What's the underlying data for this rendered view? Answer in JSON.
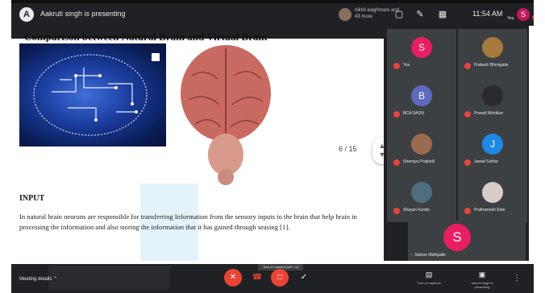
{
  "topbar": {
    "presenting_text": "Aakruti singh is presenting",
    "joined_text": "nikhil waghmare and 43 more",
    "time": "11:54 AM",
    "you_initial": "S",
    "you_label": "You"
  },
  "slide": {
    "title": "Comparison between Natural Brain and Virtual Brain",
    "page_indicator": "6 / 15",
    "section_heading": "INPUT",
    "paragraph": "In natural brain neurons are responsible for transferring Information from the sensory inputs to the brain that help brain in processing the information and also storing the information that it has gained through seasing [1]."
  },
  "participants": [
    {
      "name": "You",
      "initial": "S",
      "color": "#e91e63"
    },
    {
      "name": "Prakash Bhongade",
      "initial": "",
      "color": "#a57a3d"
    },
    {
      "name": "BCA DAON",
      "initial": "B",
      "color": "#5c6bc0"
    },
    {
      "name": "Pranali Mohitkar",
      "initial": "",
      "color": "#2a2a2a"
    },
    {
      "name": "Shanaya Prajhaili",
      "initial": "",
      "color": "#9b6b4e"
    },
    {
      "name": "Jawali Suthar",
      "initial": "J",
      "color": "#1e88e5"
    },
    {
      "name": "Shayan Kundu",
      "initial": "",
      "color": "#4e6e7f"
    },
    {
      "name": "Prathamesh Kale",
      "initial": "",
      "color": "#d7ccc8"
    }
  ],
  "big_tile": {
    "initial": "S",
    "name": "Salone Mathpalle"
  },
  "bottombar": {
    "meeting_details": "Meeting details",
    "tooltip": "Turn on camera (ctrl + e)",
    "captions_label": "Turn on captions",
    "presenting_label": "Aakruti singh is presenting"
  },
  "colors": {
    "accent_red": "#ea4335",
    "dark_bg": "#202124",
    "tile_bg": "#3c4043"
  }
}
